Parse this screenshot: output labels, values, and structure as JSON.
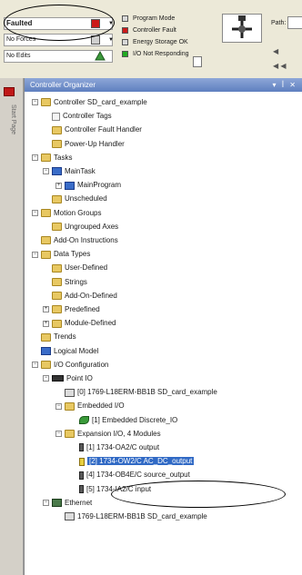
{
  "status": {
    "mode": "Faulted",
    "forces": "No Forces",
    "edits": "No Edits",
    "dropdown_glyph": "▼",
    "items": [
      {
        "label": "Program Mode",
        "color": "#d8d8d8"
      },
      {
        "label": "Controller Fault",
        "color": "#cc1a1a"
      },
      {
        "label": "Energy Storage OK",
        "color": "#d8d8d8"
      },
      {
        "label": "I/O Not Responding",
        "color": "#22aa22"
      }
    ],
    "path_label": "Path:",
    "nav_1": "◀",
    "nav_2": "◀ ◀"
  },
  "side_tab": {
    "label": "Start Page"
  },
  "organizer": {
    "title": "Controller Organizer",
    "title_controls": "▾ ꟾ ✕",
    "tree": [
      {
        "label": "Controller SD_card_example",
        "depth": 0,
        "expander": "−",
        "icon": "folder"
      },
      {
        "label": "Controller Tags",
        "depth": 1,
        "icon": "page"
      },
      {
        "label": "Controller Fault Handler",
        "depth": 1,
        "icon": "folder"
      },
      {
        "label": "Power-Up Handler",
        "depth": 1,
        "icon": "folder"
      },
      {
        "label": "Tasks",
        "depth": 0,
        "expander": "−",
        "icon": "folder"
      },
      {
        "label": "MainTask",
        "depth": 1,
        "expander": "−",
        "icon": "blueico"
      },
      {
        "label": "MainProgram",
        "depth": 2,
        "expander": "+",
        "icon": "blueico"
      },
      {
        "label": "Unscheduled",
        "depth": 1,
        "icon": "folder"
      },
      {
        "label": "Motion Groups",
        "depth": 0,
        "expander": "−",
        "icon": "folder"
      },
      {
        "label": "Ungrouped Axes",
        "depth": 1,
        "icon": "folder"
      },
      {
        "label": "Add-On Instructions",
        "depth": 0,
        "icon": "folder"
      },
      {
        "label": "Data Types",
        "depth": 0,
        "expander": "−",
        "icon": "folder"
      },
      {
        "label": "User-Defined",
        "depth": 1,
        "icon": "folder"
      },
      {
        "label": "Strings",
        "depth": 1,
        "icon": "folder"
      },
      {
        "label": "Add-On-Defined",
        "depth": 1,
        "icon": "folder"
      },
      {
        "label": "Predefined",
        "depth": 1,
        "expander": "+",
        "icon": "folder"
      },
      {
        "label": "Module-Defined",
        "depth": 1,
        "expander": "+",
        "icon": "folder"
      },
      {
        "label": "Trends",
        "depth": 0,
        "icon": "folder"
      },
      {
        "label": "Logical Model",
        "depth": 0,
        "icon": "blueico"
      },
      {
        "label": "I/O Configuration",
        "depth": 0,
        "expander": "−",
        "icon": "folder"
      },
      {
        "label": "Point IO",
        "depth": 1,
        "expander": "−",
        "icon": "darkico"
      },
      {
        "label": "[0] 1769-L18ERM-BB1B SD_card_example",
        "depth": 2,
        "icon": "modico"
      },
      {
        "label": "Embedded I/O",
        "depth": 2,
        "expander": "−",
        "icon": "folder"
      },
      {
        "label": "[1] Embedded Discrete_IO",
        "depth": 3,
        "icon": "greenico"
      },
      {
        "label": "Expansion I/O, 4 Modules",
        "depth": 2,
        "expander": "−",
        "icon": "folder"
      },
      {
        "label": "[1] 1734-OA2/C output",
        "depth": 3,
        "icon": "diskico"
      },
      {
        "label": "[2] 1734-OW2/C AC_DC_output",
        "depth": 3,
        "icon": "yellowico",
        "selected": true
      },
      {
        "label": "[4] 1734-OB4E/C source_output",
        "depth": 3,
        "icon": "diskico"
      },
      {
        "label": "[5] 1734-IA2/C input",
        "depth": 3,
        "icon": "diskico"
      },
      {
        "label": "Ethernet",
        "depth": 1,
        "expander": "−",
        "icon": "netico"
      },
      {
        "label": "1769-L18ERM-BB1B SD_card_example",
        "depth": 2,
        "icon": "modico"
      }
    ]
  }
}
